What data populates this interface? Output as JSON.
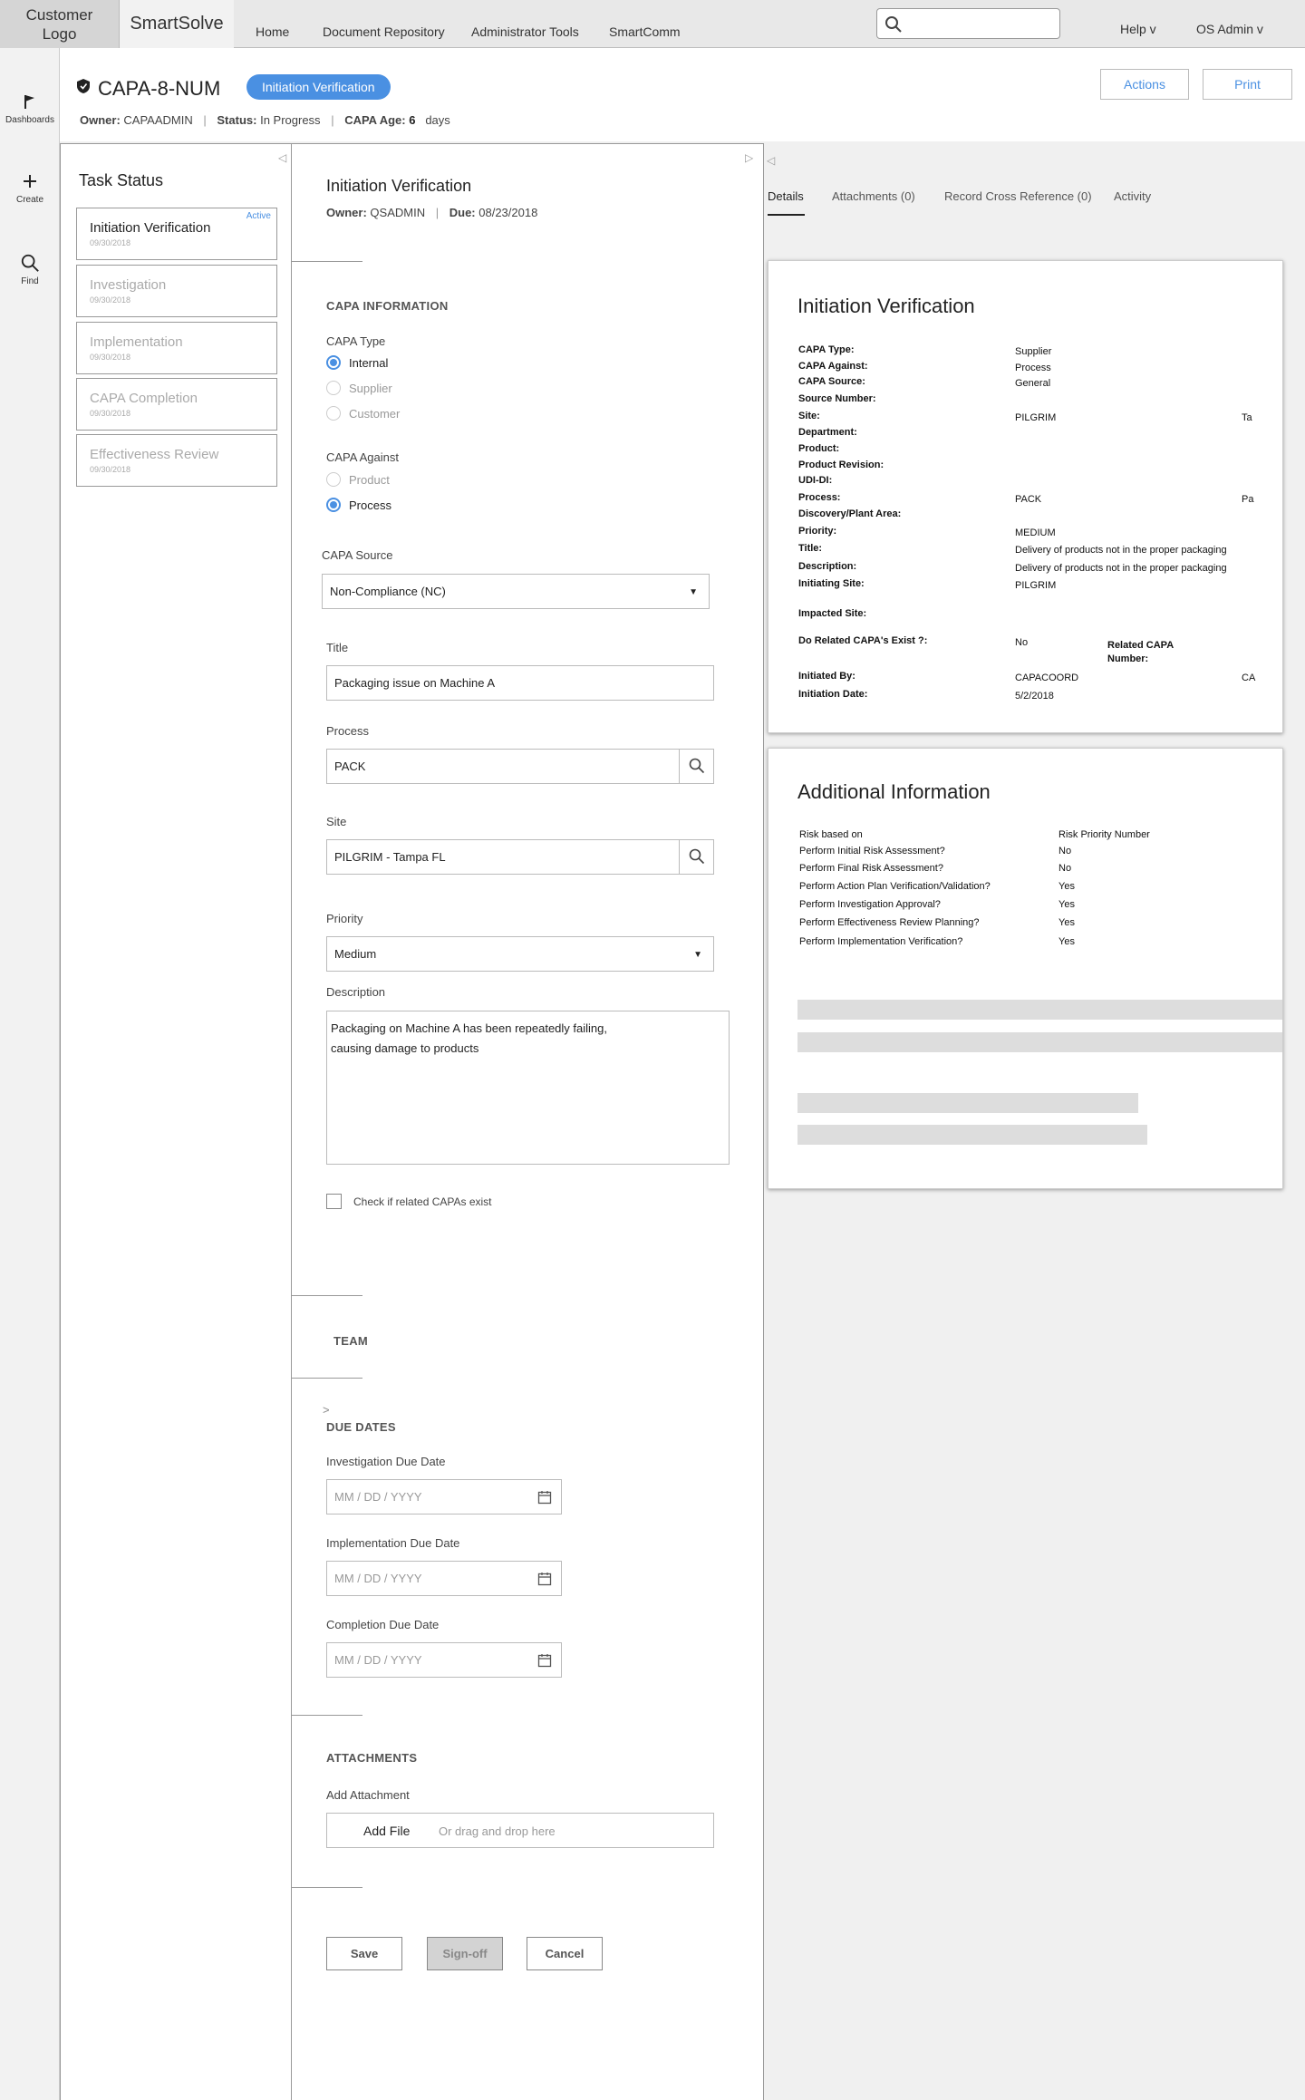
{
  "topbar": {
    "logo_line1": "Customer",
    "logo_line2": "Logo",
    "brand": "SmartSolve",
    "nav": [
      "Home",
      "Document Repository",
      "Administrator Tools",
      "SmartComm"
    ],
    "search_placeholder": "",
    "help": "Help v",
    "user": "OS Admin v"
  },
  "rail": {
    "items": [
      {
        "label": "Dashboards",
        "icon": "flag-icon"
      },
      {
        "label": "Create",
        "icon": "plus-icon"
      },
      {
        "label": "Find",
        "icon": "search-icon"
      }
    ]
  },
  "header": {
    "record_id": "CAPA-8-NUM",
    "stage_pill": "Initiation Verification",
    "owner_label": "Owner:",
    "owner_value": "CAPAADMIN",
    "status_label": "Status:",
    "status_value": "In Progress",
    "age_label": "CAPA Age:",
    "age_value": "6",
    "age_unit": "days",
    "actions_button": "Actions",
    "print_button": "Print"
  },
  "task_status": {
    "title": "Task Status",
    "tasks": [
      {
        "label": "Initiation Verification",
        "date": "09/30/2018",
        "badge": "Active"
      },
      {
        "label": "Investigation",
        "date": "09/30/2018"
      },
      {
        "label": "Implementation",
        "date": "09/30/2018"
      },
      {
        "label": "CAPA Completion",
        "date": "09/30/2018"
      },
      {
        "label": "Effectiveness Review",
        "date": "09/30/2018"
      }
    ]
  },
  "form": {
    "title": "Initiation Verification",
    "owner_label": "Owner:",
    "owner_value": "QSADMIN",
    "due_label": "Due:",
    "due_value": "08/23/2018",
    "capa_info_heading": "CAPA INFORMATION",
    "capa_type_label": "CAPA Type",
    "capa_type_options": [
      "Internal",
      "Supplier",
      "Customer"
    ],
    "capa_against_label": "CAPA Against",
    "capa_against_options": [
      "Product",
      "Process"
    ],
    "capa_source_label": "CAPA Source",
    "capa_source_value": "Non-Compliance (NC)",
    "title_label": "Title",
    "title_value": "Packaging issue on Machine A",
    "process_label": "Process",
    "process_value": "PACK",
    "site_label": "Site",
    "site_value": "PILGRIM - Tampa FL",
    "priority_label": "Priority",
    "priority_value": "Medium",
    "description_label": "Description",
    "description_value": "Packaging on Machine A has been repeatedly failing,\ncausing damage to products",
    "related_checkbox": "Check if related CAPAs exist",
    "team_heading": "TEAM",
    "due_dates_heading": "DUE DATES",
    "investigation_due_label": "Investigation Due Date",
    "implementation_due_label": "Implementation Due Date",
    "completion_due_label": "Completion Due Date",
    "date_placeholder": "MM  /  DD  /  YYYY",
    "attachments_heading": "ATTACHMENTS",
    "add_attachment_label": "Add Attachment",
    "add_file": "Add File",
    "drag_drop": "Or drag and drop here",
    "save_button": "Save",
    "signoff_button": "Sign-off",
    "cancel_button": "Cancel"
  },
  "right": {
    "tabs": [
      "Details",
      "Attachments (0)",
      "Record Cross Reference (0)",
      "Activity"
    ],
    "details_card": {
      "title": "Initiation Verification",
      "rows": [
        {
          "key": "CAPA Type:",
          "value": "Supplier"
        },
        {
          "key": "CAPA Against:",
          "value": "Process"
        },
        {
          "key": "CAPA Source:",
          "value": "General"
        },
        {
          "key": "Source Number:",
          "value": ""
        },
        {
          "key": "Site:",
          "value": "PILGRIM",
          "extra": "Ta"
        },
        {
          "key": "Department:",
          "value": ""
        },
        {
          "key": "Product:",
          "value": ""
        },
        {
          "key": "Product Revision:",
          "value": ""
        },
        {
          "key": "UDI-DI:",
          "value": ""
        },
        {
          "key": "Process:",
          "value": "PACK",
          "extra": "Pa"
        },
        {
          "key": "Discovery/Plant Area:",
          "value": ""
        },
        {
          "key": "Priority:",
          "value": "MEDIUM"
        },
        {
          "key": "Title:",
          "value": "Delivery of products not in the proper packaging"
        },
        {
          "key": "Description:",
          "value": "Delivery of products not in the proper packaging"
        },
        {
          "key": "Initiating Site:",
          "value": "PILGRIM"
        },
        {
          "key": "Impacted Site:",
          "value": ""
        },
        {
          "key": "Do Related CAPA's Exist ?:",
          "value": "No"
        },
        {
          "key": "Initiated By:",
          "value": "CAPACOORD",
          "extra": "CA"
        },
        {
          "key": "Initiation Date:",
          "value": "5/2/2018"
        }
      ],
      "related_capa_line1": "Related CAPA",
      "related_capa_line2": "Number:"
    },
    "additional_card": {
      "title": "Additional Information",
      "rows": [
        {
          "key": "Risk based on",
          "value": "Risk Priority Number"
        },
        {
          "key": "Perform Initial Risk Assessment?",
          "value": "No"
        },
        {
          "key": "Perform Final Risk Assessment?",
          "value": "No"
        },
        {
          "key": "Perform Action Plan Verification/Validation?",
          "value": "Yes"
        },
        {
          "key": "Perform Investigation Approval?",
          "value": "Yes"
        },
        {
          "key": "Perform Effectiveness Review Planning?",
          "value": "Yes"
        },
        {
          "key": "Perform Implementation Verification?",
          "value": "Yes"
        }
      ]
    }
  }
}
